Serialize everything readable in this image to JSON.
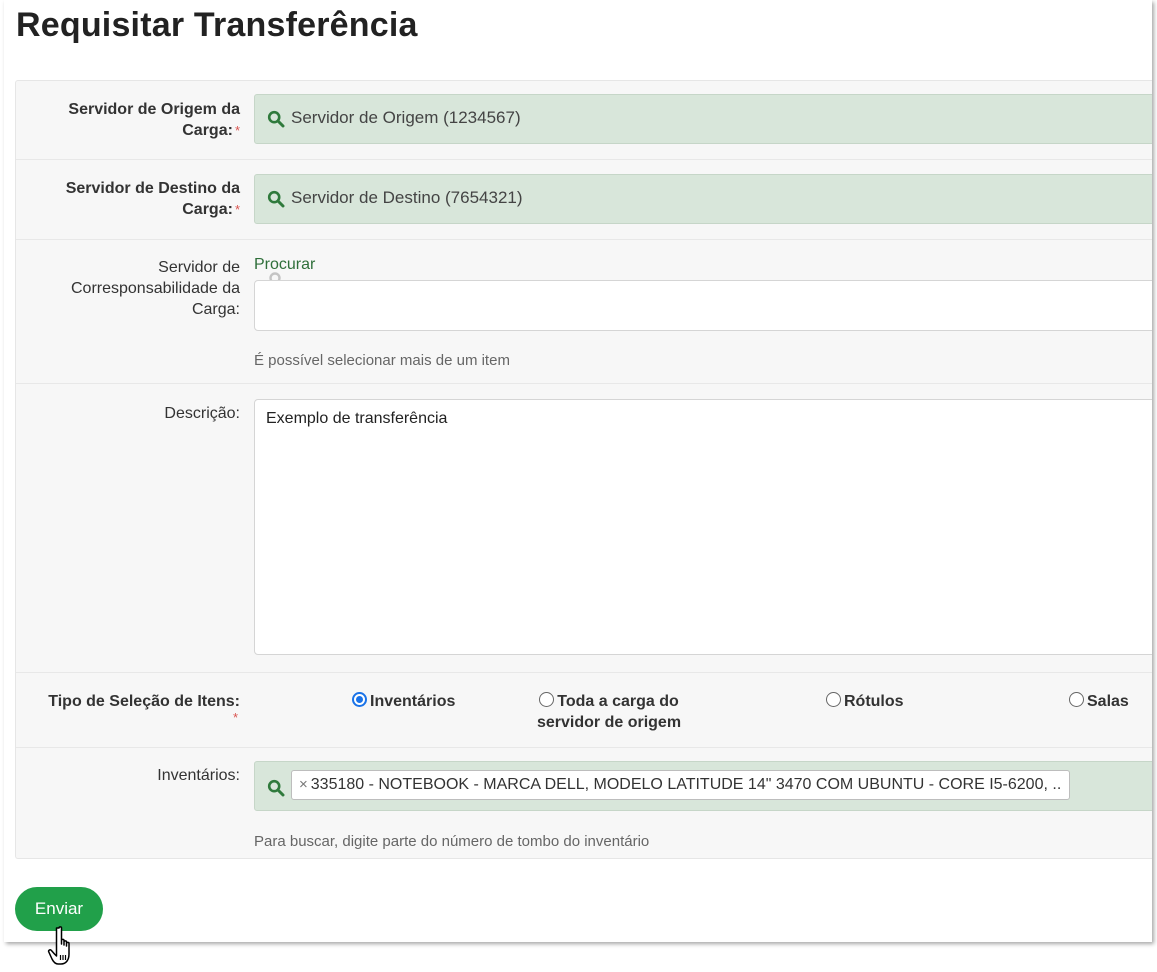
{
  "page": {
    "title": "Requisitar Transferência"
  },
  "form": {
    "origem": {
      "label_line1": "Servidor de Origem da",
      "label_line2": "Carga:",
      "required_mark": "*",
      "value": "Servidor de Origem (1234567)",
      "icon": "search-icon"
    },
    "destino": {
      "label_line1": "Servidor de Destino da",
      "label_line2": "Carga:",
      "required_mark": "*",
      "value": "Servidor de Destino (7654321)",
      "icon": "search-icon"
    },
    "corresponsabilidade": {
      "label_line1": "Servidor de",
      "label_line2": "Corresponsabilidade da",
      "label_line3": "Carga:",
      "search_link": "Procurar",
      "value": "",
      "hint": "É possível selecionar mais de um item"
    },
    "descricao": {
      "label": "Descrição:",
      "value": "Exemplo de transferência"
    },
    "tipo_selecao": {
      "label": "Tipo de Seleção de Itens:",
      "required_mark": "*",
      "options": [
        {
          "label": "Inventários",
          "checked": true
        },
        {
          "label_line1": "Toda a carga do",
          "label_line2": "servidor de origem",
          "checked": false
        },
        {
          "label": "Rótulos",
          "checked": false
        },
        {
          "label": "Salas",
          "checked": false
        }
      ]
    },
    "inventarios": {
      "label": "Inventários:",
      "remove_glyph": "×",
      "selected_item": "335180 - NOTEBOOK - MARCA DELL, MODELO LATITUDE 14\" 3470 COM UBUNTU - CORE I5-6200, ..",
      "hint": "Para buscar, digite parte do número de tombo do inventário"
    }
  },
  "submit": {
    "label": "Enviar"
  },
  "colors": {
    "accent_green": "#21a04a",
    "field_green": "#d8e6da",
    "link_green": "#2f6f3a",
    "required_red": "#d9534f",
    "radio_blue": "#1a73e8"
  }
}
